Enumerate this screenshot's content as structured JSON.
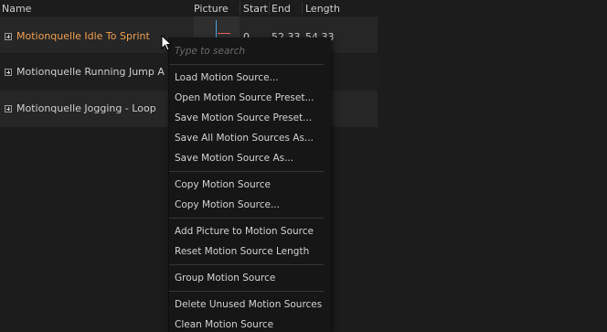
{
  "header": {
    "name": "Name",
    "picture": "Picture",
    "start": "Start",
    "end": "End",
    "length": "Length"
  },
  "rows": [
    {
      "name": "Motionquelle Idle To Sprint",
      "start": "0",
      "end": "52.33",
      "length": "54.33",
      "selected": true
    },
    {
      "name": "Motionquelle Running Jump A -"
    },
    {
      "name": "Motionquelle Jogging - Loop"
    }
  ],
  "context_menu": {
    "search_placeholder": "Type to search",
    "items": [
      "Load Motion Source...",
      "Open Motion Source Preset...",
      "Save Motion Source Preset...",
      "Save All Motion Sources As...",
      "Save Motion Source As...",
      "Copy Motion Source",
      "Copy Motion Source...",
      "Add Picture to Motion Source",
      "Reset Motion Source Length",
      "Group Motion Source",
      "Delete Unused Motion Sources",
      "Clean Motion Source"
    ]
  },
  "colors": {
    "background": "#1c1c1c",
    "selected_text": "#f0a050",
    "menu_background": "#161616"
  }
}
